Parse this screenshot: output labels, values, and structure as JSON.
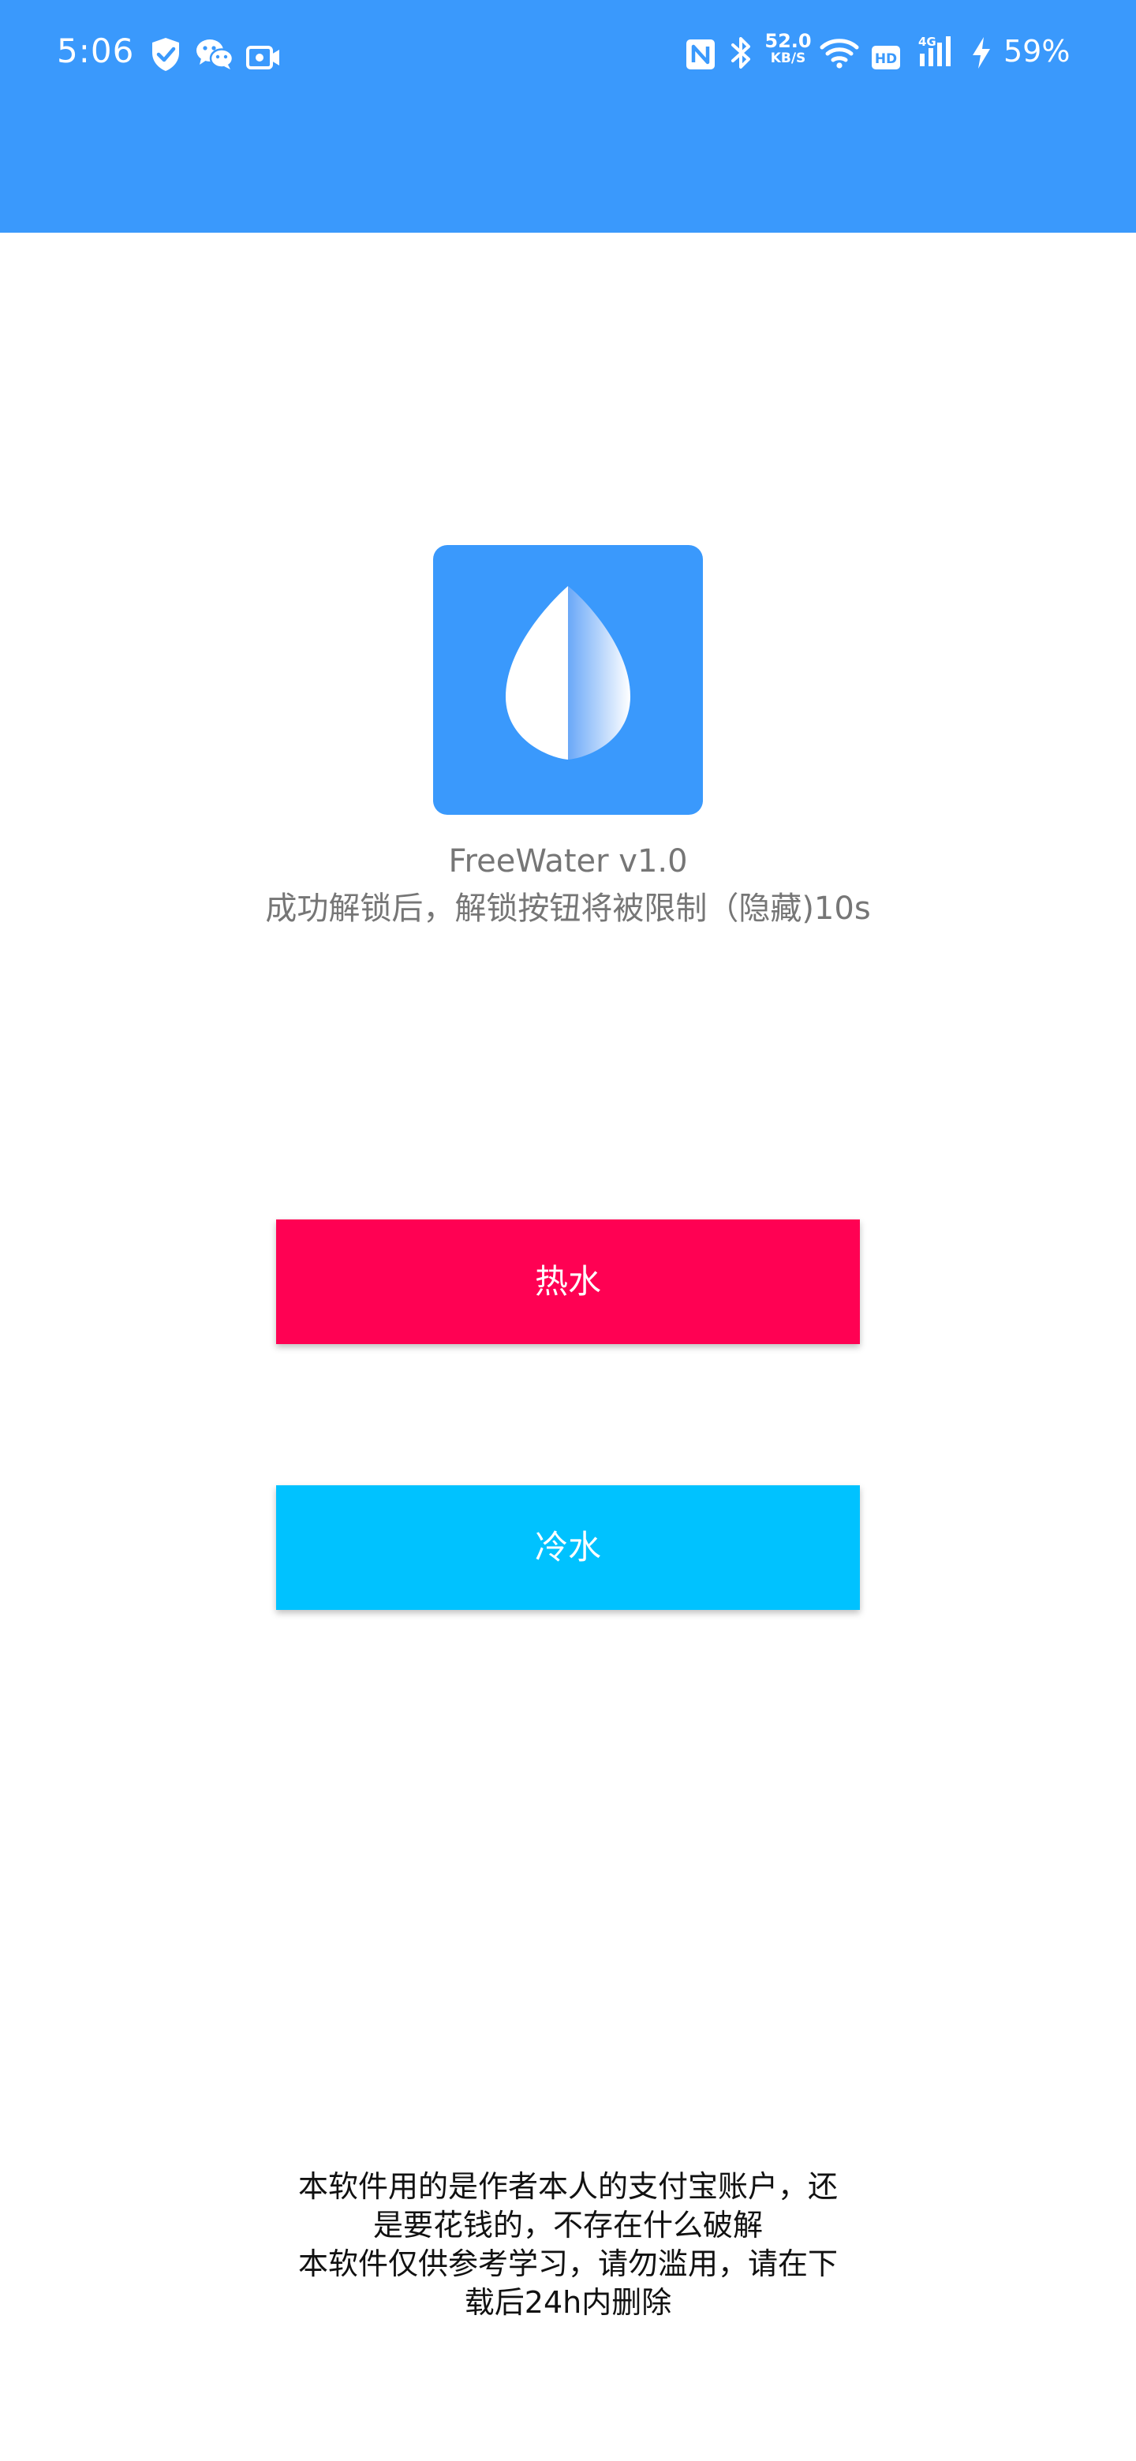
{
  "status_bar": {
    "time": "5:06",
    "net_speed_value": "52.0",
    "net_speed_unit": "KB/S",
    "battery": "59%",
    "icons": [
      "shield-check-icon",
      "wechat-icon",
      "screen-record-icon",
      "nfc-icon",
      "bluetooth-icon",
      "wifi-icon",
      "hd-icon",
      "signal-4g-icon",
      "charging-icon"
    ]
  },
  "app": {
    "logo_icon": "water-drop-icon",
    "title": "FreeWater v1.0",
    "subtitle": "成功解锁后，解锁按钮将被限制（隐藏)10s"
  },
  "buttons": {
    "hot_label": "热水",
    "cold_label": "冷水"
  },
  "disclaimer": {
    "line1": "本软件用的是作者本人的支付宝账户，还",
    "line2": "是要花钱的，不存在什么破解",
    "line3": "本软件仅供参考学习，请勿滥用，请在下",
    "line4": "载后24h内删除"
  },
  "colors": {
    "header": "#3a99fc",
    "hot_button": "#ff0153",
    "cold_button": "#00c2ff",
    "text_gray": "#767676"
  }
}
